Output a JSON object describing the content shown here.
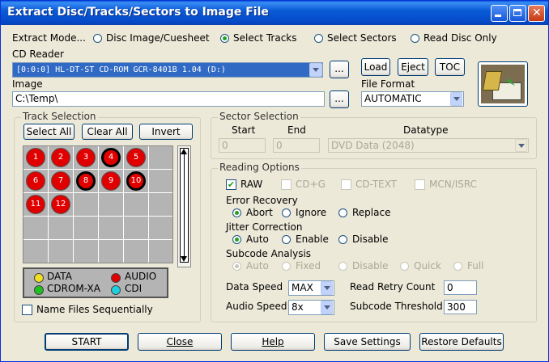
{
  "window": {
    "title": "Extract Disc/Tracks/Sectors to Image File"
  },
  "extract_mode": {
    "label": "Extract Mode...",
    "options": [
      "Disc Image/Cuesheet",
      "Select Tracks",
      "Select Sectors",
      "Read Disc Only"
    ],
    "selected": "Select Tracks"
  },
  "cd_reader": {
    "label": "CD Reader",
    "value": "[0:0:0] HL-DT-ST CD-ROM GCR-8401B 1.04 (D:)",
    "browse": "...",
    "load": "Load",
    "eject": "Eject",
    "toc": "TOC"
  },
  "image": {
    "label": "Image",
    "value": "C:\\Temp\\",
    "browse": "..."
  },
  "file_format": {
    "label": "File Format",
    "value": "AUTOMATIC"
  },
  "track_selection": {
    "label": "Track Selection",
    "select_all": "Select All",
    "clear_all": "Clear All",
    "invert": "Invert",
    "tracks": [
      "1",
      "2",
      "3",
      "4",
      "5",
      "6",
      "7",
      "8",
      "9",
      "10",
      "11",
      "12"
    ],
    "selected_tracks": [
      "4",
      "8",
      "10"
    ],
    "legend": [
      {
        "name": "DATA",
        "color": "#f0e020"
      },
      {
        "name": "AUDIO",
        "color": "#e00000"
      },
      {
        "name": "CDROM-XA",
        "color": "#20c020"
      },
      {
        "name": "CDI",
        "color": "#20d0e0"
      }
    ],
    "name_files_sequentially": "Name Files Sequentially"
  },
  "sector_selection": {
    "label": "Sector Selection",
    "start_label": "Start",
    "end_label": "End",
    "datatype_label": "Datatype",
    "start_value": "0",
    "end_value": "0",
    "datatype_value": "DVD Data (2048)"
  },
  "reading_options": {
    "label": "Reading Options",
    "raw": "RAW",
    "cdg": "CD+G",
    "cdtext": "CD-TEXT",
    "mcn": "MCN/ISRC",
    "error_recovery": {
      "label": "Error Recovery",
      "options": [
        "Abort",
        "Ignore",
        "Replace"
      ],
      "selected": "Abort"
    },
    "jitter_correction": {
      "label": "Jitter Correction",
      "options": [
        "Auto",
        "Enable",
        "Disable"
      ],
      "selected": "Auto"
    },
    "subcode_analysis": {
      "label": "Subcode Analysis",
      "options": [
        "Auto",
        "Fixed",
        "Disable",
        "Quick",
        "Full"
      ],
      "selected": "Auto"
    },
    "data_speed": {
      "label": "Data Speed",
      "value": "MAX"
    },
    "audio_speed": {
      "label": "Audio Speed",
      "value": "8x"
    },
    "read_retry_count": {
      "label": "Read Retry Count",
      "value": "0"
    },
    "subcode_threshold": {
      "label": "Subcode Threshold",
      "value": "300"
    }
  },
  "footer": {
    "start": "START",
    "close": "Close",
    "help": "Help",
    "save_settings": "Save Settings",
    "restore_defaults": "Restore Defaults"
  }
}
